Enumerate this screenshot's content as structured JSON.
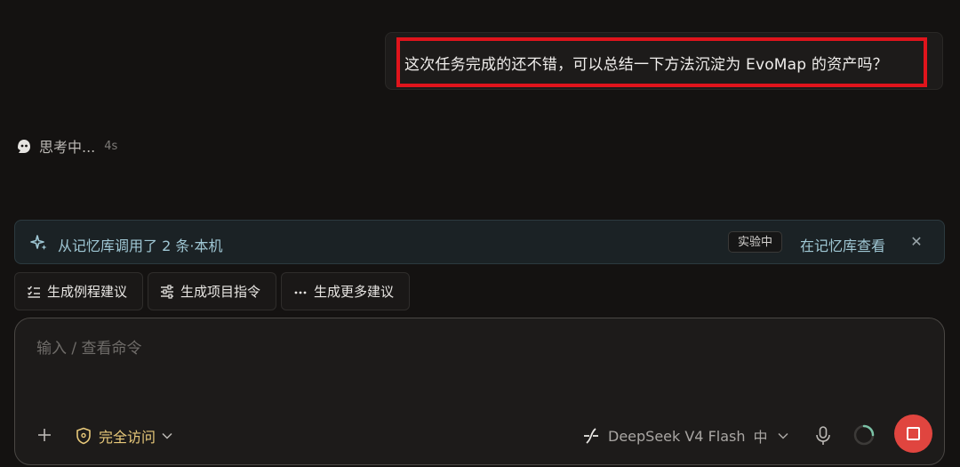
{
  "chat": {
    "user_message": "这次任务完成的还不错，可以总结一下方法沉淀为 EvoMap 的资产吗？",
    "thinking_label": "思考中...",
    "thinking_time": "4s"
  },
  "memory_banner": {
    "text": "从记忆库调用了 2 条·本机",
    "badge": "实验中",
    "link": "在记忆库查看",
    "close": "✕"
  },
  "suggestions": [
    {
      "label": "生成例程建议",
      "icon": "checklist-icon"
    },
    {
      "label": "生成项目指令",
      "icon": "sliders-icon"
    },
    {
      "label": "生成更多建议",
      "icon": "ellipsis-icon"
    }
  ],
  "composer": {
    "placeholder": "输入 / 查看命令",
    "access_label": "完全访问",
    "model_name": "DeepSeek V4 Flash",
    "model_level": "中"
  },
  "colors": {
    "background": "#141211",
    "highlight": "#e0141c",
    "access": "#e8c97a",
    "memory_text": "#9fc7d4",
    "stop_button": "#e0453f"
  }
}
